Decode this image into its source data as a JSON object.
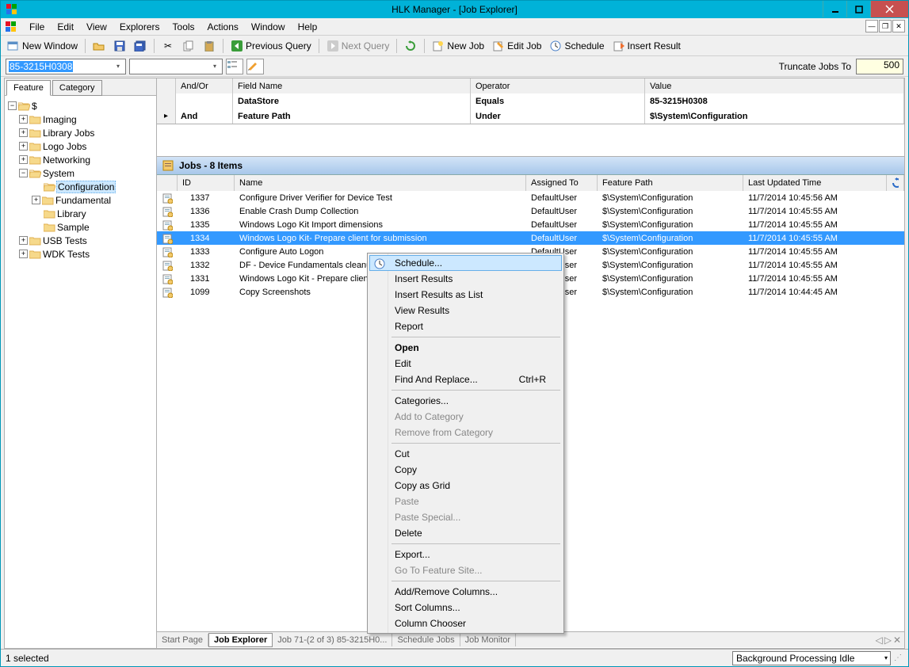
{
  "window": {
    "title": "HLK Manager - [Job Explorer]"
  },
  "menubar": [
    "File",
    "Edit",
    "View",
    "Explorers",
    "Tools",
    "Actions",
    "Window",
    "Help"
  ],
  "toolbar": {
    "new_window": "New Window",
    "prev_query": "Previous Query",
    "next_query": "Next Query",
    "new_job": "New Job",
    "edit_job": "Edit Job",
    "schedule": "Schedule",
    "insert_result": "Insert Result"
  },
  "filterbar": {
    "combo1": "85-3215H0308",
    "combo2": "",
    "truncate_label": "Truncate Jobs To",
    "truncate_value": "500"
  },
  "left_tabs": {
    "feature": "Feature",
    "category": "Category"
  },
  "tree": {
    "root": "$",
    "nodes": [
      {
        "label": "Imaging",
        "expand": "+",
        "indent": 1
      },
      {
        "label": "Library Jobs",
        "expand": "+",
        "indent": 1
      },
      {
        "label": "Logo Jobs",
        "expand": "+",
        "indent": 1
      },
      {
        "label": "Networking",
        "expand": "+",
        "indent": 1
      },
      {
        "label": "System",
        "expand": "-",
        "indent": 1,
        "open": true
      },
      {
        "label": "Configuration",
        "expand": "",
        "indent": 2,
        "selected": true,
        "open": true
      },
      {
        "label": "Fundamental",
        "expand": "+",
        "indent": 2
      },
      {
        "label": "Library",
        "expand": "",
        "indent": 2
      },
      {
        "label": "Sample",
        "expand": "",
        "indent": 2
      },
      {
        "label": "USB Tests",
        "expand": "+",
        "indent": 1
      },
      {
        "label": "WDK Tests",
        "expand": "+",
        "indent": 1
      }
    ]
  },
  "criteria": {
    "headers": {
      "andor": "And/Or",
      "field": "Field Name",
      "op": "Operator",
      "value": "Value"
    },
    "rows": [
      {
        "andor": "",
        "field": "DataStore",
        "op": "Equals",
        "value": "85-3215H0308",
        "bold": true
      },
      {
        "andor": "And",
        "field": "Feature Path",
        "op": "Under",
        "value": "$\\System\\Configuration",
        "bold": true,
        "marker": true
      }
    ]
  },
  "jobs_header": "Jobs - 8 Items",
  "jobs_cols": {
    "id": "ID",
    "name": "Name",
    "assigned": "Assigned To",
    "feature": "Feature Path",
    "updated": "Last Updated Time"
  },
  "jobs": [
    {
      "id": "1337",
      "name": "Configure Driver Verifier for Device Test",
      "assigned": "DefaultUser",
      "feature": "$\\System\\Configuration",
      "updated": "11/7/2014 10:45:56 AM"
    },
    {
      "id": "1336",
      "name": "Enable Crash Dump Collection",
      "assigned": "DefaultUser",
      "feature": "$\\System\\Configuration",
      "updated": "11/7/2014 10:45:55 AM"
    },
    {
      "id": "1335",
      "name": "Windows Logo Kit Import dimensions",
      "assigned": "DefaultUser",
      "feature": "$\\System\\Configuration",
      "updated": "11/7/2014 10:45:55 AM"
    },
    {
      "id": "1334",
      "name": "Windows Logo Kit- Prepare client for submission",
      "assigned": "DefaultUser",
      "feature": "$\\System\\Configuration",
      "updated": "11/7/2014 10:45:55 AM",
      "selected": true
    },
    {
      "id": "1333",
      "name": "Configure Auto Logon",
      "assigned": "DefaultUser",
      "feature": "$\\System\\Configuration",
      "updated": "11/7/2014 10:45:55 AM"
    },
    {
      "id": "1332",
      "name": "DF - Device Fundamentals cleanup",
      "assigned": "DefaultUser",
      "feature": "$\\System\\Configuration",
      "updated": "11/7/2014 10:45:55 AM"
    },
    {
      "id": "1331",
      "name": "Windows Logo Kit - Prepare client",
      "assigned": "DefaultUser",
      "feature": "$\\System\\Configuration",
      "updated": "11/7/2014 10:45:55 AM"
    },
    {
      "id": "1099",
      "name": "Copy Screenshots",
      "assigned": "DefaultUser",
      "feature": "$\\System\\Configuration",
      "updated": "11/7/2014 10:44:45 AM"
    }
  ],
  "context_menu": [
    {
      "label": "Schedule...",
      "hover": true,
      "icon": true
    },
    {
      "label": "Insert Results"
    },
    {
      "label": "Insert Results as List"
    },
    {
      "label": "View Results"
    },
    {
      "label": "Report"
    },
    {
      "sep": true
    },
    {
      "label": "Open",
      "bold": true
    },
    {
      "label": "Edit"
    },
    {
      "label": "Find And Replace...",
      "shortcut": "Ctrl+R"
    },
    {
      "sep": true
    },
    {
      "label": "Categories..."
    },
    {
      "label": "Add to Category",
      "disabled": true
    },
    {
      "label": "Remove from Category",
      "disabled": true
    },
    {
      "sep": true
    },
    {
      "label": "Cut"
    },
    {
      "label": "Copy"
    },
    {
      "label": "Copy as Grid"
    },
    {
      "label": "Paste",
      "disabled": true
    },
    {
      "label": "Paste Special...",
      "disabled": true
    },
    {
      "label": "Delete"
    },
    {
      "sep": true
    },
    {
      "label": "Export..."
    },
    {
      "label": "Go To Feature Site...",
      "disabled": true
    },
    {
      "sep": true
    },
    {
      "label": "Add/Remove Columns..."
    },
    {
      "label": "Sort Columns..."
    },
    {
      "label": "Column Chooser"
    }
  ],
  "bottom_tabs": [
    "Start Page",
    "Job Explorer",
    "Job 71-(2 of 3) 85-3215H0...",
    "Schedule Jobs",
    "Job Monitor"
  ],
  "bottom_active": 1,
  "statusbar": {
    "left": "1 selected",
    "right": "Background Processing Idle"
  }
}
